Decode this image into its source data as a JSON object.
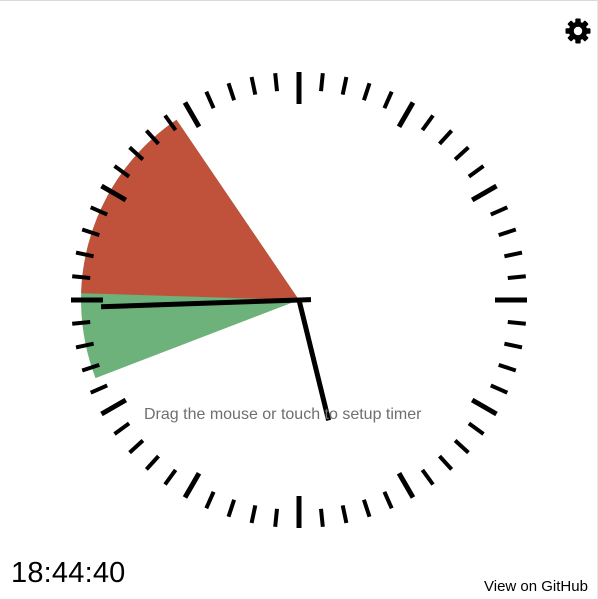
{
  "hint": "Drag the mouse or touch to setup timer",
  "current_time": "18:44:40",
  "github_link": "View on GitHub",
  "icons": {
    "settings": "gear-icon"
  },
  "timer": {
    "colors": {
      "elapsed": "#c0523b",
      "remaining": "#6cb27a",
      "ticks": "#000000",
      "hands": "#000000"
    },
    "hands": {
      "hour": 5.54,
      "minute": 44.67
    },
    "sectors": [
      {
        "kind": "remaining",
        "from_minute": 41.5,
        "to_minute": 54.3
      },
      {
        "kind": "elapsed",
        "from_minute": 45.3,
        "to_minute": 54.3
      }
    ]
  }
}
